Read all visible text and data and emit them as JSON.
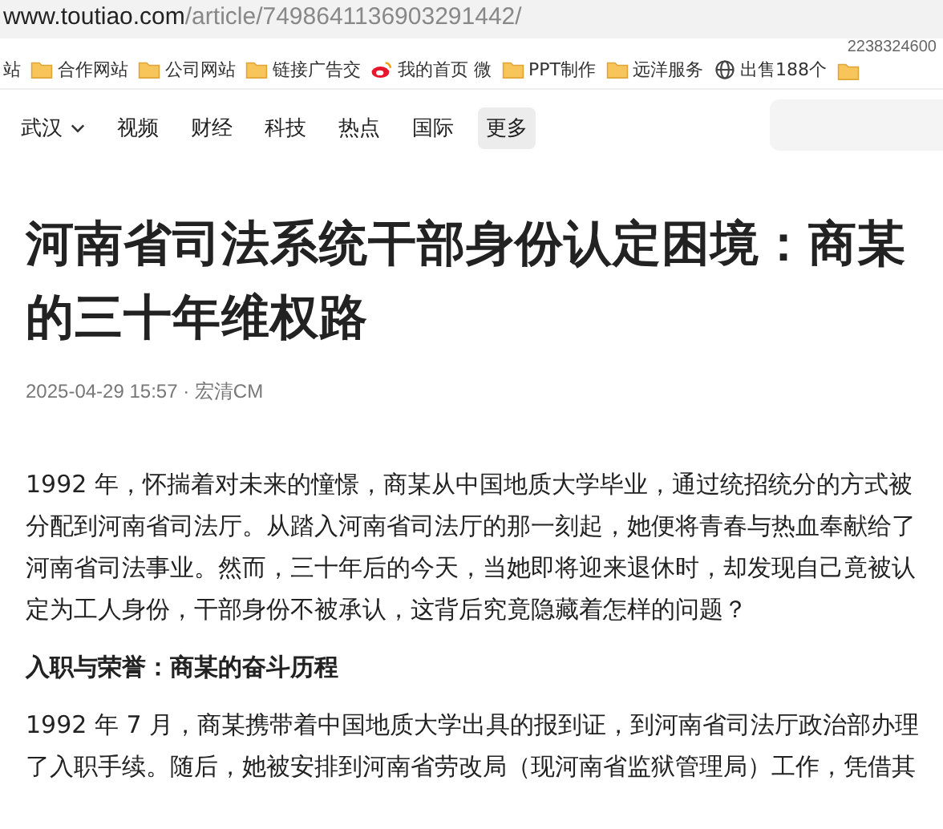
{
  "address_bar": {
    "domain": "www.toutiao.com",
    "path": "/article/7498641136903291442/"
  },
  "bookmarks": [
    {
      "label": "站",
      "kind": "none"
    },
    {
      "label": "合作网站",
      "kind": "folder"
    },
    {
      "label": "公司网站",
      "kind": "folder"
    },
    {
      "label": "链接广告交",
      "kind": "folder"
    },
    {
      "label": "我的首页 微",
      "kind": "weibo"
    },
    {
      "label": "PPT制作",
      "kind": "folder"
    },
    {
      "label": "远洋服务",
      "kind": "folder"
    },
    {
      "label": "出售188个",
      "kind": "globe"
    },
    {
      "kind": "folder"
    }
  ],
  "bookmark_overlay": "2238324600",
  "nav": {
    "items": [
      {
        "label": "武汉",
        "dropdown": true,
        "selected": false
      },
      {
        "label": "视频",
        "dropdown": false,
        "selected": false
      },
      {
        "label": "财经",
        "dropdown": false,
        "selected": false
      },
      {
        "label": "科技",
        "dropdown": false,
        "selected": false
      },
      {
        "label": "热点",
        "dropdown": false,
        "selected": false
      },
      {
        "label": "国际",
        "dropdown": false,
        "selected": false
      },
      {
        "label": "更多",
        "dropdown": false,
        "selected": true
      }
    ]
  },
  "article": {
    "title": "河南省司法系统干部身份认定困境：商某的三十年维权路",
    "meta": "2025-04-29 15:57 · 宏清CM",
    "blocks": [
      {
        "kind": "paragraph",
        "text": "1992 年，怀揣着对未来的憧憬，商某从中国地质大学毕业，通过统招统分的方式被分配到河南省司法厅。从踏入河南省司法厅的那一刻起，她便将青春与热血奉献给了河南省司法事业。然而，三十年后的今天，当她即将迎来退休时，却发现自己竟被认定为工人身份，干部身份不被承认，这背后究竟隐藏着怎样的问题？"
      },
      {
        "kind": "heading",
        "text": "入职与荣誉：商某的奋斗历程"
      },
      {
        "kind": "paragraph",
        "text": "1992 年 7 月，商某携带着中国地质大学出具的报到证，到河南省司法厅政治部办理了入职手续。随后，她被安排到河南省劳改局（现河南省监狱管理局）工作，凭借其"
      }
    ]
  }
}
